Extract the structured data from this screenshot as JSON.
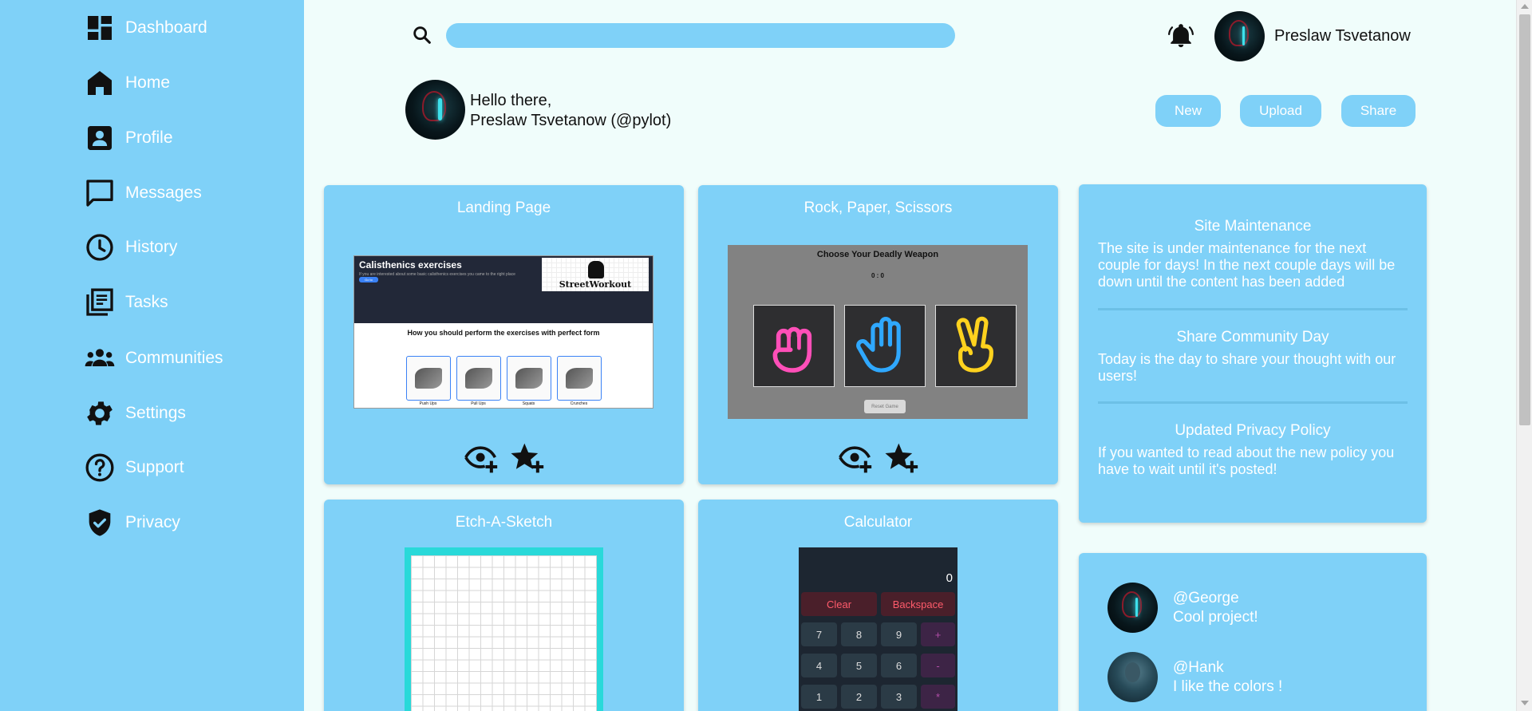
{
  "sidebar": {
    "items": [
      {
        "label": "Dashboard",
        "icon": "dashboard-icon"
      },
      {
        "label": "Home",
        "icon": "home-icon"
      },
      {
        "label": "Profile",
        "icon": "profile-icon"
      },
      {
        "label": "Messages",
        "icon": "messages-icon"
      },
      {
        "label": "History",
        "icon": "history-icon"
      },
      {
        "label": "Tasks",
        "icon": "tasks-icon"
      },
      {
        "label": "Communities",
        "icon": "communities-icon"
      },
      {
        "label": "Settings",
        "icon": "gear-icon"
      },
      {
        "label": "Support",
        "icon": "help-icon"
      },
      {
        "label": "Privacy",
        "icon": "shield-icon"
      }
    ]
  },
  "header": {
    "search_placeholder": "",
    "user_name": "Preslaw Tsvetanow"
  },
  "greeting": {
    "line1": "Hello there,",
    "line2": "Preslaw Tsvetanow (@pylot)"
  },
  "actions": {
    "new": "New",
    "upload": "Upload",
    "share": "Share"
  },
  "projects": [
    {
      "title": "Landing Page",
      "preview": {
        "title": "Calisthenics exercises",
        "subtitle": "If you are interested about some basic calisthenics exercises you came to the right place",
        "button": "Go to",
        "brand": "StreetWorkout",
        "heading": "How you should perform the exercises with perfect form",
        "items": [
          "Push Ups",
          "Pull Ups",
          "Squats",
          "Crunches"
        ]
      }
    },
    {
      "title": "Rock, Paper, Scissors",
      "preview": {
        "title": "Choose Your Deadly Weapon",
        "score": "0 : 0",
        "reset": "Reset Game"
      }
    },
    {
      "title": "Etch-A-Sketch"
    },
    {
      "title": "Calculator",
      "preview": {
        "display": "0",
        "clear": "Clear",
        "backspace": "Backspace",
        "rows": [
          [
            "7",
            "8",
            "9",
            "+"
          ],
          [
            "4",
            "5",
            "6",
            "-"
          ],
          [
            "1",
            "2",
            "3",
            "*"
          ]
        ]
      }
    }
  ],
  "announcements": [
    {
      "title": "Site Maintenance",
      "text": "The site is under maintenance for the next couple for days! In the next couple days will be down until the content has been added"
    },
    {
      "title": "Share Community Day",
      "text": "Today is the day to share your thought with our users!"
    },
    {
      "title": "Updated Privacy Policy",
      "text": "If you wanted to read about the new policy you have to wait until it's posted!"
    }
  ],
  "comments": [
    {
      "user": "@George",
      "text": "Cool project!"
    },
    {
      "user": "@Hank",
      "text": "I like the colors !"
    }
  ],
  "colors": {
    "accent": "#7fd1f8",
    "background": "#f0fdfb",
    "text": "#111111",
    "rock": "#ff4fb8",
    "paper": "#2fa8ff",
    "scissors": "#ffd21e"
  }
}
